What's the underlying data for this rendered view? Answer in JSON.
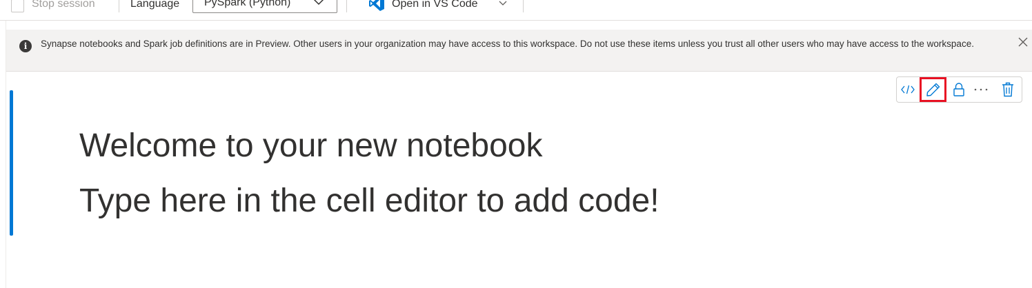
{
  "toolbar": {
    "stop_session_label": "Stop session",
    "language_label": "Language",
    "language_value": "PySpark (Python)",
    "open_vscode_label": "Open in VS Code"
  },
  "banner": {
    "text": "Synapse notebooks and Spark job definitions are in Preview. Other users in your organization may have access to this workspace. Do not use these items unless you trust all other users who may have access to the workspace."
  },
  "cell": {
    "lines": [
      "Welcome to your new notebook",
      "Type here in the cell editor to add code!"
    ]
  },
  "colors": {
    "accent": "#0078d4",
    "highlight": "#e81123"
  },
  "icons": {
    "code": "code-icon",
    "edit": "pencil-icon",
    "lock": "lock-icon",
    "more": "more-icon",
    "delete": "trash-icon",
    "close": "close-icon",
    "info": "info-icon"
  }
}
